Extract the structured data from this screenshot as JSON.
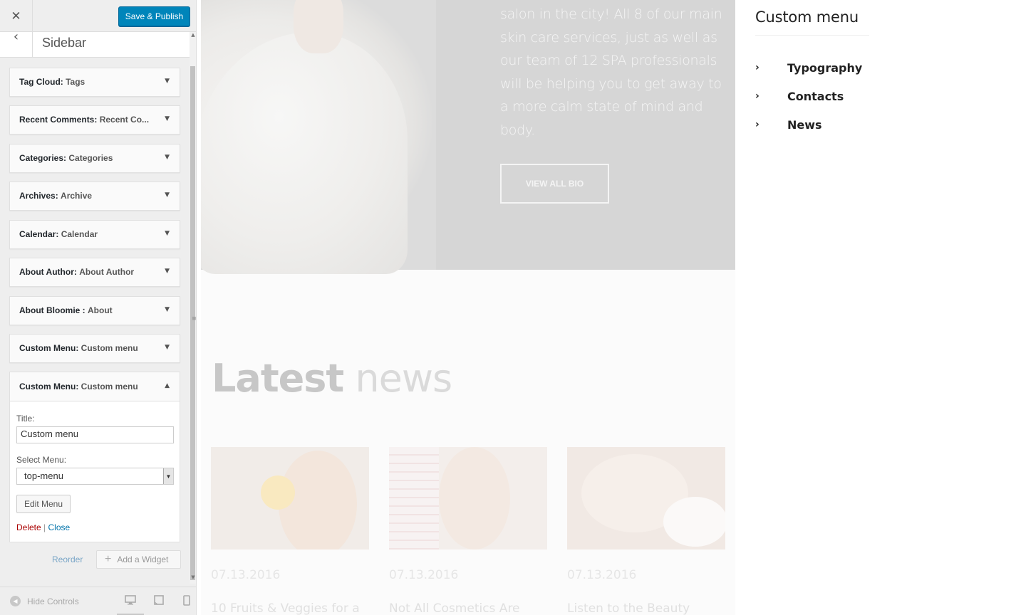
{
  "customizer": {
    "close_icon": "close-icon",
    "publish_label": "Save & Publish",
    "back_icon": "chevron-left-icon",
    "section_title": "Sidebar",
    "widgets": [
      {
        "type": "Tag Cloud:",
        "title": "Tags"
      },
      {
        "type": "Recent Comments:",
        "title": "Recent Co..."
      },
      {
        "type": "Categories:",
        "title": "Categories"
      },
      {
        "type": "Archives:",
        "title": "Archive"
      },
      {
        "type": "Calendar:",
        "title": "Calendar"
      },
      {
        "type": "About Author:",
        "title": "About Author"
      },
      {
        "type": "About Bloomie :",
        "title": "About"
      },
      {
        "type": "Custom Menu:",
        "title": "Custom menu"
      }
    ],
    "open_widget": {
      "type": "Custom Menu:",
      "title": "Custom menu",
      "title_label": "Title:",
      "title_value": "Custom menu",
      "select_label": "Select Menu:",
      "select_value": "top-menu",
      "edit_menu_label": "Edit Menu",
      "delete_label": "Delete",
      "separator": "|",
      "close_label": "Close"
    },
    "reorder_label": "Reorder",
    "add_widget_label": "Add a Widget",
    "hide_controls_label": "Hide Controls",
    "devices": [
      "desktop-icon",
      "tablet-icon",
      "mobile-icon"
    ]
  },
  "preview": {
    "hero_text": "salon in the city! All 8 of our main skin care services, just as well as our team of 12 SPA professionals will be helping you to get away to a more calm state of mind and body.",
    "bio_button": "VIEW ALL BIO",
    "news_title_bold": "Latest",
    "news_title_light": "news",
    "news": [
      {
        "date": "07.13.2016",
        "title": "10 Fruits & Veggies for a"
      },
      {
        "date": "07.13.2016",
        "title": "Not All Cosmetics Are"
      },
      {
        "date": "07.13.2016",
        "title": "Listen to the Beauty"
      }
    ]
  },
  "sidebar": {
    "title": "Custom menu",
    "items": [
      {
        "label": "Typography"
      },
      {
        "label": "Contacts"
      },
      {
        "label": "News"
      }
    ]
  },
  "colors": {
    "accent": "#0085ba",
    "delete": "#aa0000",
    "link": "#0073aa"
  }
}
